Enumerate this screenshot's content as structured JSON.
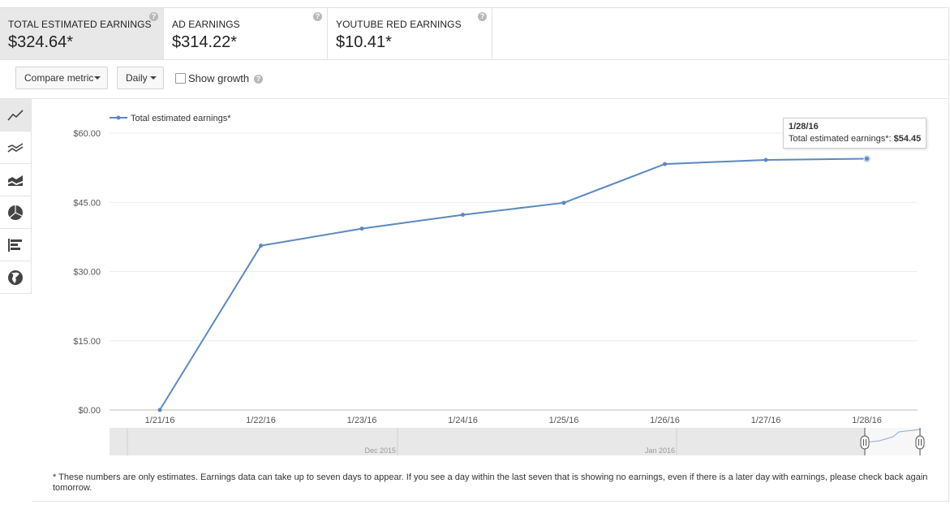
{
  "metrics": [
    {
      "label": "TOTAL ESTIMATED EARNINGS",
      "value": "$324.64*",
      "selected": true
    },
    {
      "label": "AD EARNINGS",
      "value": "$314.22*",
      "selected": false
    },
    {
      "label": "YOUTUBE RED EARNINGS",
      "value": "$10.41*",
      "selected": false
    }
  ],
  "help_glyph": "?",
  "toolbar": {
    "compare_metric_label": "Compare metric",
    "interval_label": "Daily",
    "show_growth_label": "Show growth",
    "show_growth_checked": false
  },
  "sidebar": {
    "items": [
      {
        "icon": "line-chart-icon",
        "active": true
      },
      {
        "icon": "multi-line-chart-icon",
        "active": false
      },
      {
        "icon": "stacked-area-chart-icon",
        "active": false
      },
      {
        "icon": "pie-chart-icon",
        "active": false
      },
      {
        "icon": "bar-chart-icon",
        "active": false
      },
      {
        "icon": "globe-icon",
        "active": false
      }
    ]
  },
  "chart_data": {
    "type": "line",
    "categories": [
      "1/21/16",
      "1/22/16",
      "1/23/16",
      "1/24/16",
      "1/25/16",
      "1/26/16",
      "1/27/16",
      "1/28/16"
    ],
    "series": [
      {
        "name": "Total estimated earnings*",
        "values": [
          0.0,
          35.6,
          39.3,
          42.3,
          44.9,
          53.3,
          54.2,
          54.45
        ],
        "color": "#5b88c2"
      }
    ],
    "yticks": [
      "$0.00",
      "$15.00",
      "$30.00",
      "$45.00",
      "$60.00"
    ],
    "ylim": [
      0,
      60
    ],
    "grid": true,
    "legend": "top-left"
  },
  "tooltip": {
    "date": "1/28/16",
    "series_label": "Total estimated earnings*:",
    "value": "$54.45"
  },
  "timeline": {
    "labels": [
      "Dec 2015",
      "Jan 2016"
    ]
  },
  "footnote": "* These numbers are only estimates. Earnings data can take up to seven days to appear. If you see a day within the last seven that is showing no earnings, even if there is a later day with earnings, please check back again tomorrow."
}
